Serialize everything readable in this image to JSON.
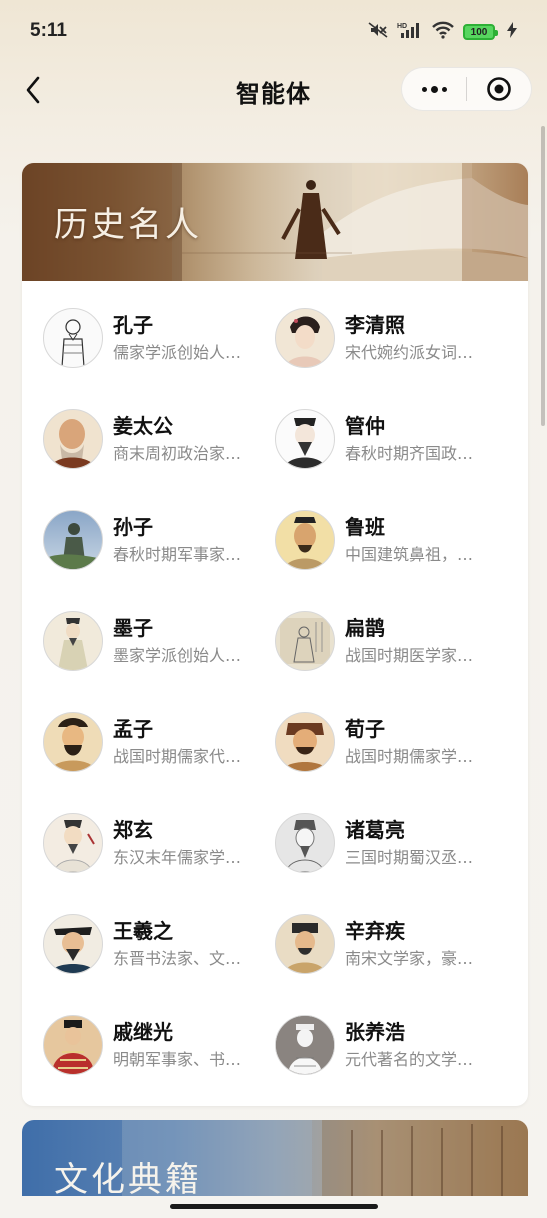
{
  "status_bar": {
    "time": "5:11",
    "battery": "100",
    "icons": [
      "mute-icon",
      "hd-signal-icon",
      "wifi-icon",
      "battery-icon",
      "charging-icon"
    ]
  },
  "nav": {
    "title": "智能体",
    "back_icon": "chevron-left-icon",
    "more_icon": "more-dots-icon",
    "close_icon": "target-circle-icon"
  },
  "sections": [
    {
      "title": "历史名人",
      "people": [
        {
          "name": "孔子",
          "desc": "儒家学派创始人…"
        },
        {
          "name": "李清照",
          "desc": "宋代婉约派女词…"
        },
        {
          "name": "姜太公",
          "desc": "商末周初政治家…"
        },
        {
          "name": "管仲",
          "desc": "春秋时期齐国政…"
        },
        {
          "name": "孙子",
          "desc": "春秋时期军事家…"
        },
        {
          "name": "鲁班",
          "desc": "中国建筑鼻祖，…"
        },
        {
          "name": "墨子",
          "desc": "墨家学派创始人…"
        },
        {
          "name": "扁鹊",
          "desc": "战国时期医学家…"
        },
        {
          "name": "孟子",
          "desc": "战国时期儒家代…"
        },
        {
          "name": "荀子",
          "desc": "战国时期儒家学…"
        },
        {
          "name": "郑玄",
          "desc": "东汉末年儒家学…"
        },
        {
          "name": "诸葛亮",
          "desc": "三国时期蜀汉丞…"
        },
        {
          "name": "王羲之",
          "desc": "东晋书法家、文…"
        },
        {
          "name": "辛弃疾",
          "desc": "南宋文学家，豪…"
        },
        {
          "name": "戚继光",
          "desc": "明朝军事家、书…"
        },
        {
          "name": "张养浩",
          "desc": "元代著名的文学…"
        }
      ]
    },
    {
      "title": "文化典籍"
    }
  ],
  "colors": {
    "accent_brown": "#6b4225",
    "desc_gray": "#8a8a8a"
  }
}
